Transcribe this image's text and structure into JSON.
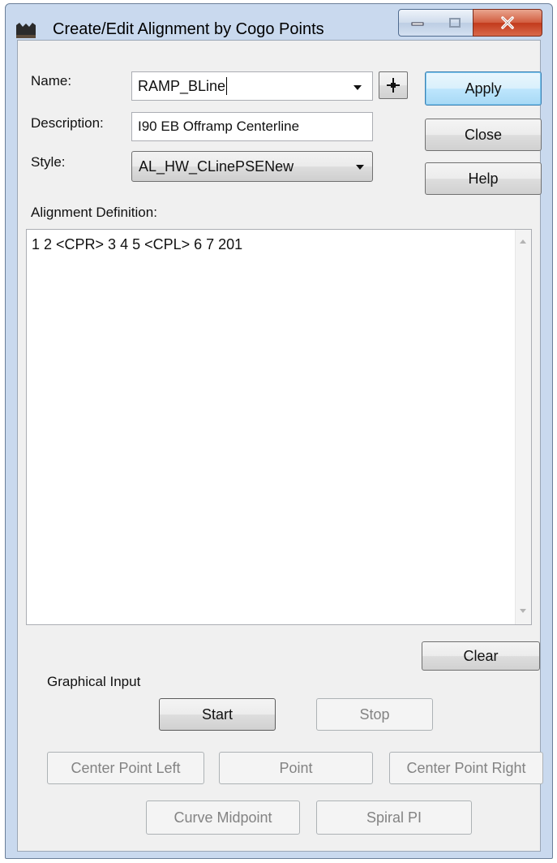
{
  "window": {
    "title": "Create/Edit Alignment by Cogo Points"
  },
  "form": {
    "name_label": "Name:",
    "name_value": "RAMP_BLine",
    "description_label": "Description:",
    "description_value": "I90 EB Offramp Centerline",
    "style_label": "Style:",
    "style_value": "AL_HW_CLinePSENew",
    "alignment_definition_label": "Alignment Definition:",
    "alignment_definition_value": "1 2  <CPR> 3 4 5  <CPL> 6 7 201"
  },
  "buttons": {
    "apply": "Apply",
    "close": "Close",
    "help": "Help",
    "clear": "Clear"
  },
  "graphical_input": {
    "label": "Graphical Input",
    "start": "Start",
    "stop": "Stop",
    "center_point_left": "Center Point Left",
    "point": "Point",
    "center_point_right": "Center Point Right",
    "curve_midpoint": "Curve Midpoint",
    "spiral_pi": "Spiral PI"
  },
  "icons": {
    "app": "alignment-app-icon",
    "pick_point": "crosshair-icon",
    "minimize": "minimize-icon",
    "maximize": "maximize-icon",
    "close": "close-icon"
  },
  "colors": {
    "titlebar": "#c9d9ee",
    "close_button": "#c23a1c",
    "default_button": "#a7d9f5",
    "disabled_text": "#838383"
  }
}
